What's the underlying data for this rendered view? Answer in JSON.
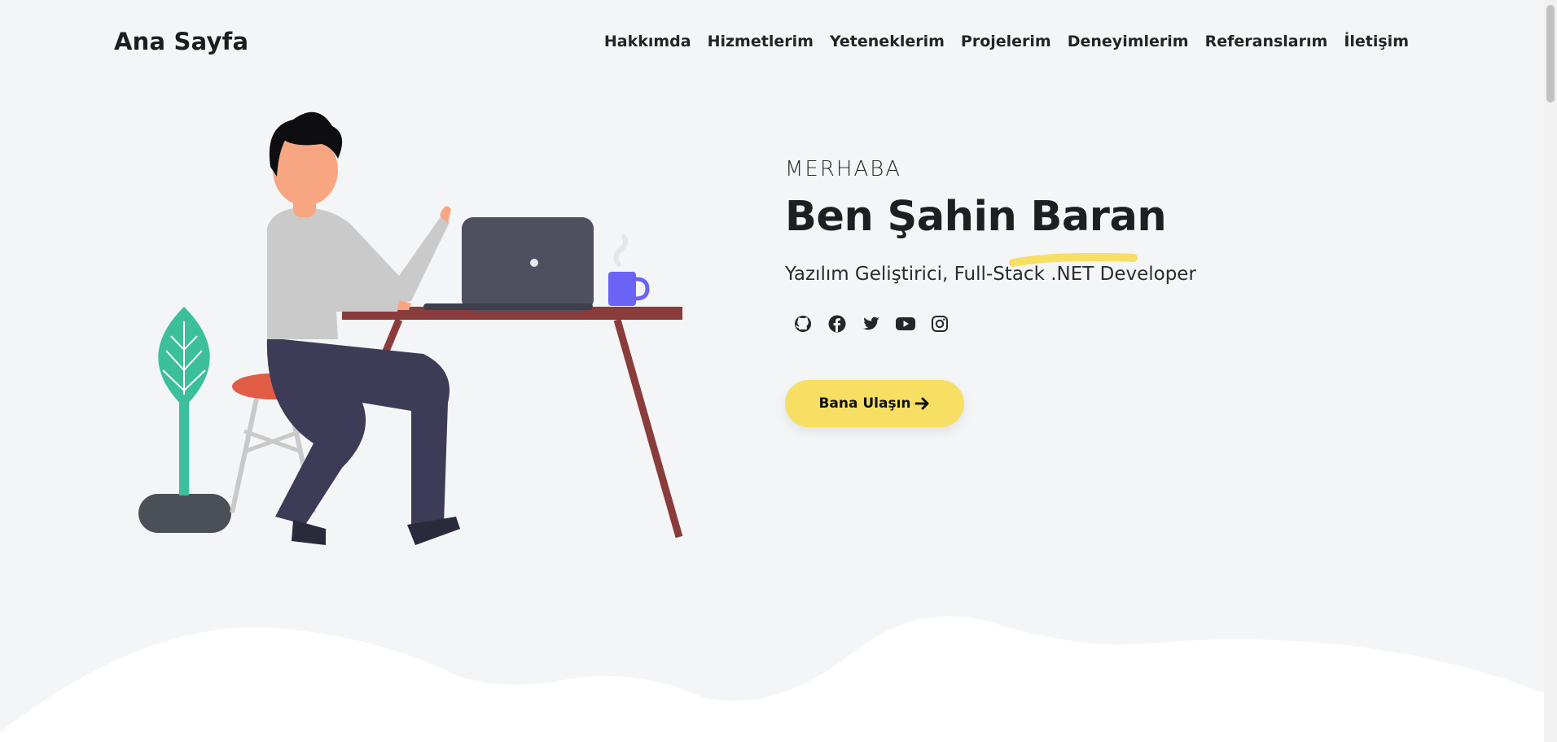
{
  "header": {
    "brand": "Ana Sayfa",
    "nav": [
      {
        "label": "Hakkımda"
      },
      {
        "label": "Hizmetlerim"
      },
      {
        "label": "Yeteneklerim"
      },
      {
        "label": "Projelerim"
      },
      {
        "label": "Deneyimlerim"
      },
      {
        "label": "Referanslarım"
      },
      {
        "label": "İletişim"
      }
    ]
  },
  "hero": {
    "greeting": "MERHABA",
    "title": "Ben Şahin Baran",
    "subtitle": "Yazılım Geliştirici, Full-Stack .NET Developer",
    "cta_label": "Bana Ulaşın",
    "cta_icon": "arrow-right-icon",
    "socials": [
      {
        "icon": "github-icon"
      },
      {
        "icon": "facebook-icon"
      },
      {
        "icon": "twitter-icon"
      },
      {
        "icon": "youtube-icon"
      },
      {
        "icon": "instagram-icon"
      }
    ]
  },
  "colors": {
    "background": "#f4f5f7",
    "accent": "#f7df63",
    "text": "#1e1f22"
  }
}
